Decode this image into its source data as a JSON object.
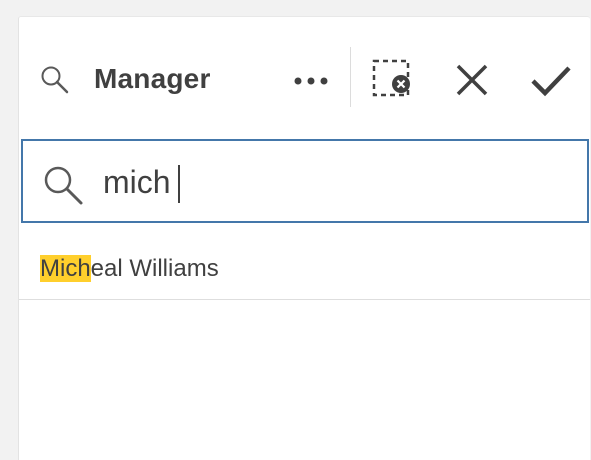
{
  "header": {
    "title": "Manager",
    "search_icon": "search-icon",
    "more_icon": "more-horizontal-icon",
    "clear_selections_icon": "clear-selections-icon",
    "cancel_icon": "close-icon",
    "confirm_icon": "checkmark-icon"
  },
  "search": {
    "value": "mich",
    "icon": "search-icon"
  },
  "results": [
    {
      "match": "Mich",
      "rest": "eal Williams"
    }
  ],
  "colors": {
    "accent_border": "#4477aa",
    "highlight": "#ffcf2c",
    "text": "#404040"
  }
}
